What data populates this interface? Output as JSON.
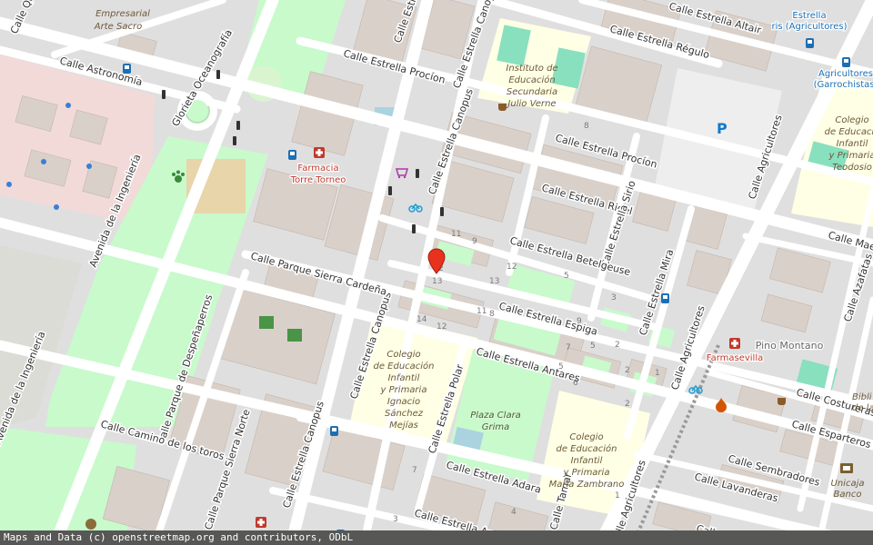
{
  "attribution": "Maps and Data (c) openstreetmap.org and contributors, ODbL",
  "marker": {
    "name": "selected-location-marker"
  },
  "streets": [
    "Calle Astronomía",
    "Glorieta Oceanografía",
    "Avenida de la Ingeniería",
    "Avenida de la Ingeniería",
    "Calle Estrella Procíon",
    "Calle Estrella Canopus",
    "Calle Estrella Canopus",
    "Calle Estrella Canopus",
    "Calle Estrella Canopus",
    "Calle Estrella Canopus",
    "Calle Estrella Régulo",
    "Calle Estrella Altair",
    "Calle Estrella Procíon",
    "Calle Estrella Rigel",
    "Calle Estrella Sirio",
    "Calle Estrella Betelgeuse",
    "Calle Estrella Mira",
    "Calle Agricultores",
    "Calle Agricultores",
    "Calle Agricultores",
    "Calle Parque Sierra Cardeña",
    "Calle Estrella Espiga",
    "Calle Estrella Antares",
    "Calle Estrella Polar",
    "Calle Parque de Despeñaperros",
    "Calle Parque Sierra Norte",
    "Calle Camino de los toros",
    "Calle Estrella Adara",
    "Calle Estrella Agena",
    "Calle Maes",
    "Calle Azafatas",
    "Calle Costureras",
    "Calle Esparteros",
    "Calle Sembradores",
    "Calle Lavanderas",
    "Calle Cristaleros",
    "Calle Qu",
    "Calle Tamar"
  ],
  "pois": {
    "park_top": "Parque Empresarial Arte Sacro",
    "school_verne": "Instituto de Educación Secundaria Julio Verne",
    "school_teodosio": "Colegio de Educación Infantil y Primaria Teodosio",
    "school_sanchez": "Colegio de Educación Infantil y Primaria Ignacio Sánchez Mejías",
    "school_zambrano": "Colegio de Educación Infantil y Primaria María Zambrano",
    "pharmacy_torre": "Farmacia Torre Torneo",
    "pharmacy_sevilla": "Farmasevilla",
    "plaza": "Plaza Clara Grima",
    "district": "Pino Montano",
    "bus_estrella": "Estrella ris (Agricultores)",
    "bus_agricultores": "Agricultores (Garrochistas)",
    "unicaja": "Unicaja Banco",
    "biblio": "Bibli de la",
    "parking": "P"
  },
  "house_numbers": [
    "11",
    "9",
    "2",
    "12",
    "13",
    "5",
    "13",
    "11",
    "8",
    "3",
    "14",
    "12",
    "9",
    "7",
    "5",
    "2",
    "5",
    "6",
    "2",
    "1",
    "2",
    "7",
    "3",
    "4",
    "8",
    "3",
    "4",
    "1"
  ],
  "colors": {
    "background": "#f2efe9",
    "building": "#d9d0c9",
    "park": "#c8facc",
    "school": "#ffffe5",
    "residential": "#e0dfdf",
    "road": "#ffffff",
    "commercial": "#f2dad9",
    "marker": "#e8321e",
    "pharmacy": "#c0392b",
    "bus": "#1b6fb5"
  }
}
